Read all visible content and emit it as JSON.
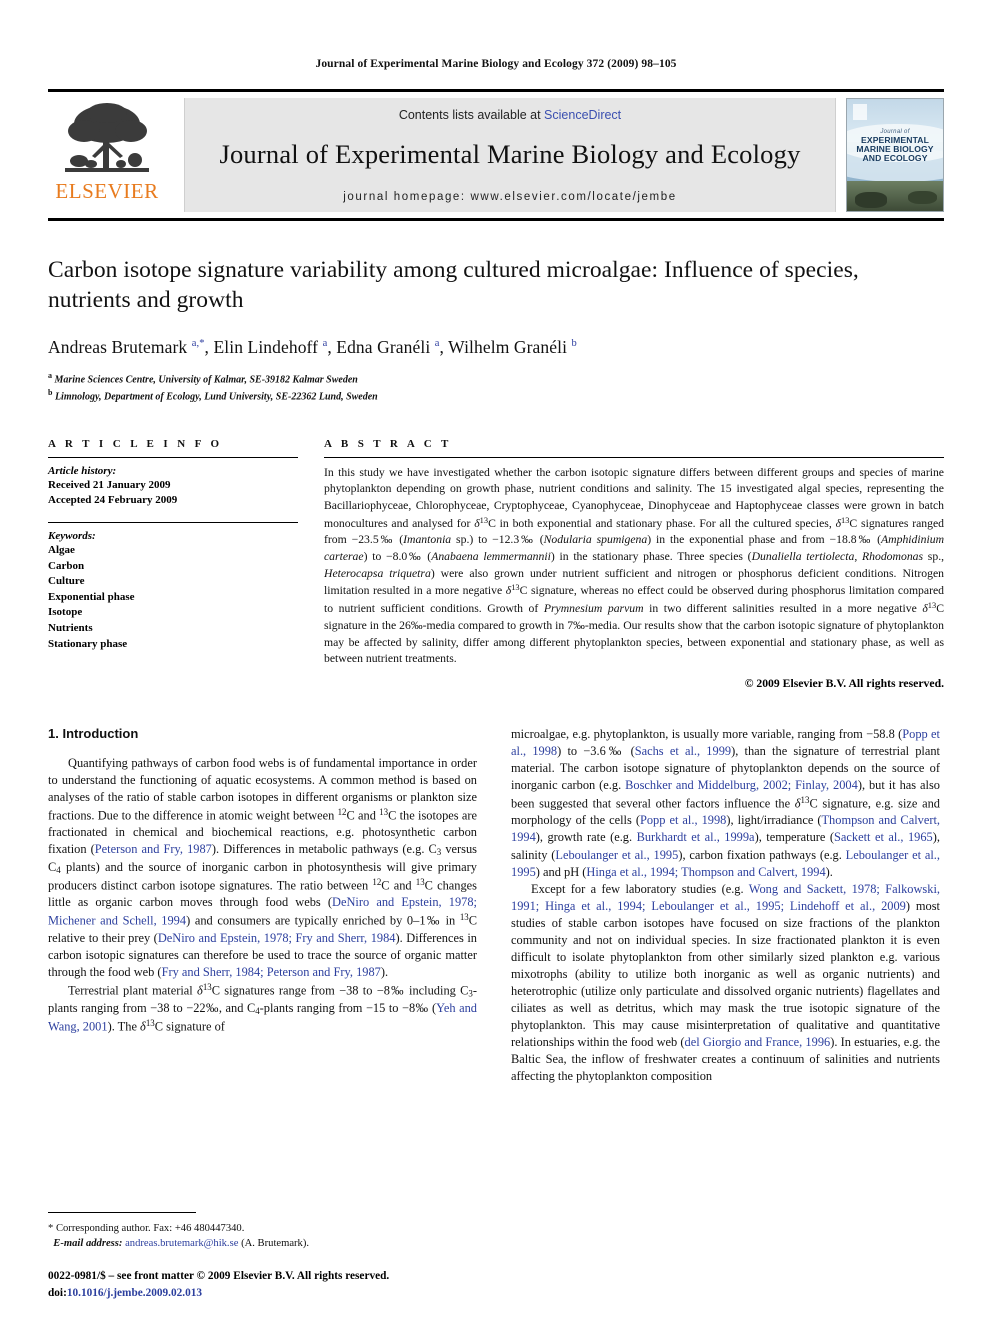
{
  "running_head": "Journal of Experimental Marine Biology and Ecology 372 (2009) 98–105",
  "masthead": {
    "publisher_name": "ELSEVIER",
    "contents_prefix": "Contents lists available at ",
    "sciencedirect_link": "ScienceDirect",
    "journal_name": "Journal of Experimental Marine Biology and Ecology",
    "homepage_line": "journal homepage: www.elsevier.com/locate/jembe",
    "cover": {
      "line1": "Journal of",
      "line2": "EXPERIMENTAL",
      "line3": "MARINE BIOLOGY",
      "line4": "AND ECOLOGY"
    },
    "link_color": "#3a4fb0",
    "elsevier_orange": "#E87B1E"
  },
  "title": "Carbon isotope signature variability among cultured microalgae: Influence of species, nutrients and growth",
  "authors_html": "Andreas Brutemark <sup>a,*</sup>, Elin Lindehoff <sup>a</sup>, Edna Granéli <sup>a</sup>, Wilhelm Granéli <sup>b</sup>",
  "affiliations": [
    {
      "marker": "a",
      "text": "Marine Sciences Centre, University of Kalmar, SE-39182 Kalmar Sweden"
    },
    {
      "marker": "b",
      "text": "Limnology, Department of Ecology, Lund University, SE-22362 Lund, Sweden"
    }
  ],
  "article_info": {
    "heading": "A R T I C L E    I N F O",
    "history_label": "Article history:",
    "history": [
      "Received 21 January 2009",
      "Accepted 24 February 2009"
    ],
    "keywords_label": "Keywords:",
    "keywords": [
      "Algae",
      "Carbon",
      "Culture",
      "Exponential phase",
      "Isotope",
      "Nutrients",
      "Stationary phase"
    ]
  },
  "abstract": {
    "heading": "A B S T R A C T",
    "body_html": "In this study we have investigated whether the carbon isotopic signature differs between different groups and species of marine phytoplankton depending on growth phase, nutrient conditions and salinity. The 15 investigated algal species, representing the Bacillariophyceae, Chlorophyceae, Cryptophyceae, Cyanophyceae, Dinophyceae and Haptophyceae classes were grown in batch monocultures and analysed for <i>&delta;</i><sup class=\"sup\">13</sup>C in both exponential and stationary phase. For all the cultured species, <i>&delta;</i><sup class=\"sup\">13</sup>C signatures ranged from &minus;23.5&permil; (<i>Imantonia</i> sp.) to &minus;12.3&permil; (<i>Nodularia spumigena</i>) in the exponential phase and from &minus;18.8&permil; (<i>Amphidinium carterae</i>) to &minus;8.0&permil; (<i>Anabaena lemmermannii</i>) in the stationary phase. Three species (<i>Dunaliella tertiolecta</i>, <i>Rhodomonas</i> sp., <i>Heterocapsa triquetra</i>) were also grown under nutrient sufficient and nitrogen or phosphorus deficient conditions. Nitrogen limitation resulted in a more negative <i>&delta;</i><sup class=\"sup\">13</sup>C signature, whereas no effect could be observed during phosphorus limitation compared to nutrient sufficient conditions. Growth of <i>Prymnesium parvum</i> in two different salinities resulted in a more negative <i>&delta;</i><sup class=\"sup\">13</sup>C signature in the 26&permil;-media compared to growth in 7&permil;-media. Our results show that the carbon isotopic signature of phytoplankton may be affected by salinity, differ among different phytoplankton species, between exponential and stationary phase, as well as between nutrient treatments.",
    "copyright": "© 2009 Elsevier B.V. All rights reserved."
  },
  "body": {
    "section_title": "1. Introduction",
    "left_paragraphs_html": [
      "Quantifying pathways of carbon food webs is of fundamental importance in order to understand the functioning of aquatic ecosystems. A common method is based on analyses of the ratio of stable carbon isotopes in different organisms or plankton size fractions. Due to the difference in atomic weight between <sup class=\"sup\">12</sup>C and <sup class=\"sup\">13</sup>C the isotopes are fractionated in chemical and biochemical reactions, e.g. photosynthetic carbon fixation (<span class=\"ref\">Peterson and Fry, 1987</span>). Differences in metabolic pathways (e.g. C<sub class=\"sub\">3</sub> versus C<sub class=\"sub\">4</sub> plants) and the source of inorganic carbon in photosynthesis will give primary producers distinct carbon isotope signatures. The ratio between <sup class=\"sup\">12</sup>C and <sup class=\"sup\">13</sup>C changes little as organic carbon moves through food webs (<span class=\"ref\">DeNiro and Epstein, 1978; Michener and Schell, 1994</span>) and consumers are typically enriched by 0&ndash;1&permil; in <sup class=\"sup\">13</sup>C relative to their prey (<span class=\"ref\">DeNiro and Epstein, 1978; Fry and Sherr, 1984</span>). Differences in carbon isotopic signatures can therefore be used to trace the source of organic matter through the food web (<span class=\"ref\">Fry and Sherr, 1984; Peterson and Fry, 1987</span>).",
      "Terrestrial plant material <i>&delta;</i><sup class=\"sup\">13</sup>C signatures range from &minus;38 to &minus;8&permil; including C<sub class=\"sub\">3</sub>-plants ranging from &minus;38 to &minus;22&permil;, and C<sub class=\"sub\">4</sub>-plants ranging from &minus;15 to &minus;8&permil; (<span class=\"ref\">Yeh and Wang, 2001</span>). The <i>&delta;</i><sup class=\"sup\">13</sup>C signature of"
    ],
    "right_paragraphs_html": [
      "microalgae, e.g. phytoplankton, is usually more variable, ranging from &minus;58.8 (<span class=\"ref\">Popp et al., 1998</span>) to &minus;3.6&permil; (<span class=\"ref\">Sachs et al., 1999</span>), than the signature of terrestrial plant material. The carbon isotope signature of phytoplankton depends on the source of inorganic carbon (e.g. <span class=\"ref\">Boschker and Middelburg, 2002; Finlay, 2004</span>), but it has also been suggested that several other factors influence the <i>&delta;</i><sup class=\"sup\">13</sup>C signature, e.g. size and morphology of the cells (<span class=\"ref\">Popp et al., 1998</span>), light/irradiance (<span class=\"ref\">Thompson and Calvert, 1994</span>), growth rate (e.g. <span class=\"ref\">Burkhardt et al., 1999a</span>), temperature (<span class=\"ref\">Sackett et al., 1965</span>), salinity (<span class=\"ref\">Leboulanger et al., 1995</span>), carbon fixation pathways (e.g. <span class=\"ref\">Leboulanger et al., 1995</span>) and pH (<span class=\"ref\">Hinga et al., 1994; Thompson and Calvert, 1994</span>).",
      "Except for a few laboratory studies (e.g. <span class=\"ref\">Wong and Sackett, 1978; Falkowski, 1991; Hinga et al., 1994; Leboulanger et al., 1995; Lindehoff et al., 2009</span>) most studies of stable carbon isotopes have focused on size fractions of the plankton community and not on individual species. In size fractionated plankton it is even difficult to isolate phytoplankton from other similarly sized plankton e.g. various mixotrophs (ability to utilize both inorganic as well as organic nutrients) and heterotrophic (utilize only particulate and dissolved organic nutrients) flagellates and ciliates as well as detritus, which may mask the true isotopic signature of the phytoplankton. This may cause misinterpretation of qualitative and quantitative relationships within the food web (<span class=\"ref\">del Giorgio and France, 1996</span>). In estuaries, e.g. the Baltic Sea, the inflow of freshwater creates a continuum of salinities and nutrients affecting the phytoplankton composition"
    ]
  },
  "footnotes": {
    "corresponding_html": "* Corresponding author. Fax: +46 480447340.",
    "email_label": "E-mail address:",
    "email": "andreas.brutemark@hik.se",
    "email_suffix": "(A. Brutemark).",
    "imprint_line": "0022-0981/$ – see front matter © 2009 Elsevier B.V. All rights reserved.",
    "doi_label": "doi:",
    "doi": "10.1016/j.jembe.2009.02.013"
  }
}
